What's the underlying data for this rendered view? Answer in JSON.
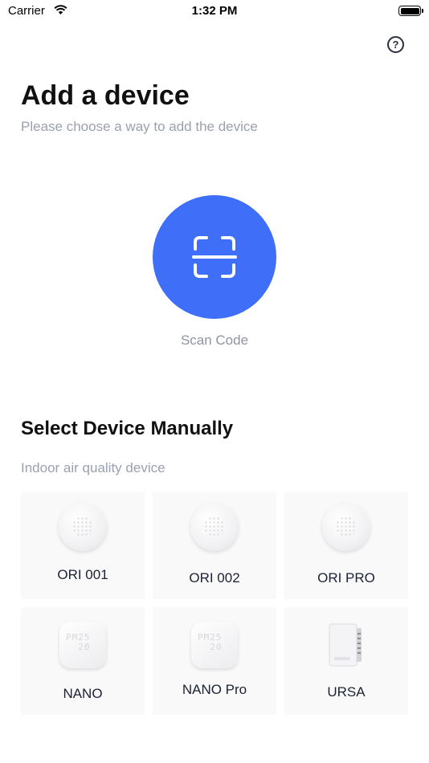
{
  "status_bar": {
    "carrier": "Carrier",
    "time": "1:32 PM"
  },
  "header": {
    "help_icon": "question-circle-icon",
    "help_glyph": "?"
  },
  "page": {
    "title": "Add a device",
    "subtitle": "Please choose a way to add the device"
  },
  "scan": {
    "icon": "scan-frame-icon",
    "label": "Scan Code",
    "color": "#3f6ef8"
  },
  "manual": {
    "section_title": "Select Device Manually",
    "category": "Indoor air quality device",
    "devices": [
      {
        "name": "ORI 001",
        "icon": "round-sensor-icon"
      },
      {
        "name": "ORI 002",
        "icon": "round-sensor-icon"
      },
      {
        "name": "ORI PRO",
        "icon": "round-sensor-icon"
      },
      {
        "name": "NANO",
        "icon": "square-sensor-icon"
      },
      {
        "name": "NANO Pro",
        "icon": "square-sensor-icon"
      },
      {
        "name": "URSA",
        "icon": "box-sensor-icon"
      }
    ]
  }
}
